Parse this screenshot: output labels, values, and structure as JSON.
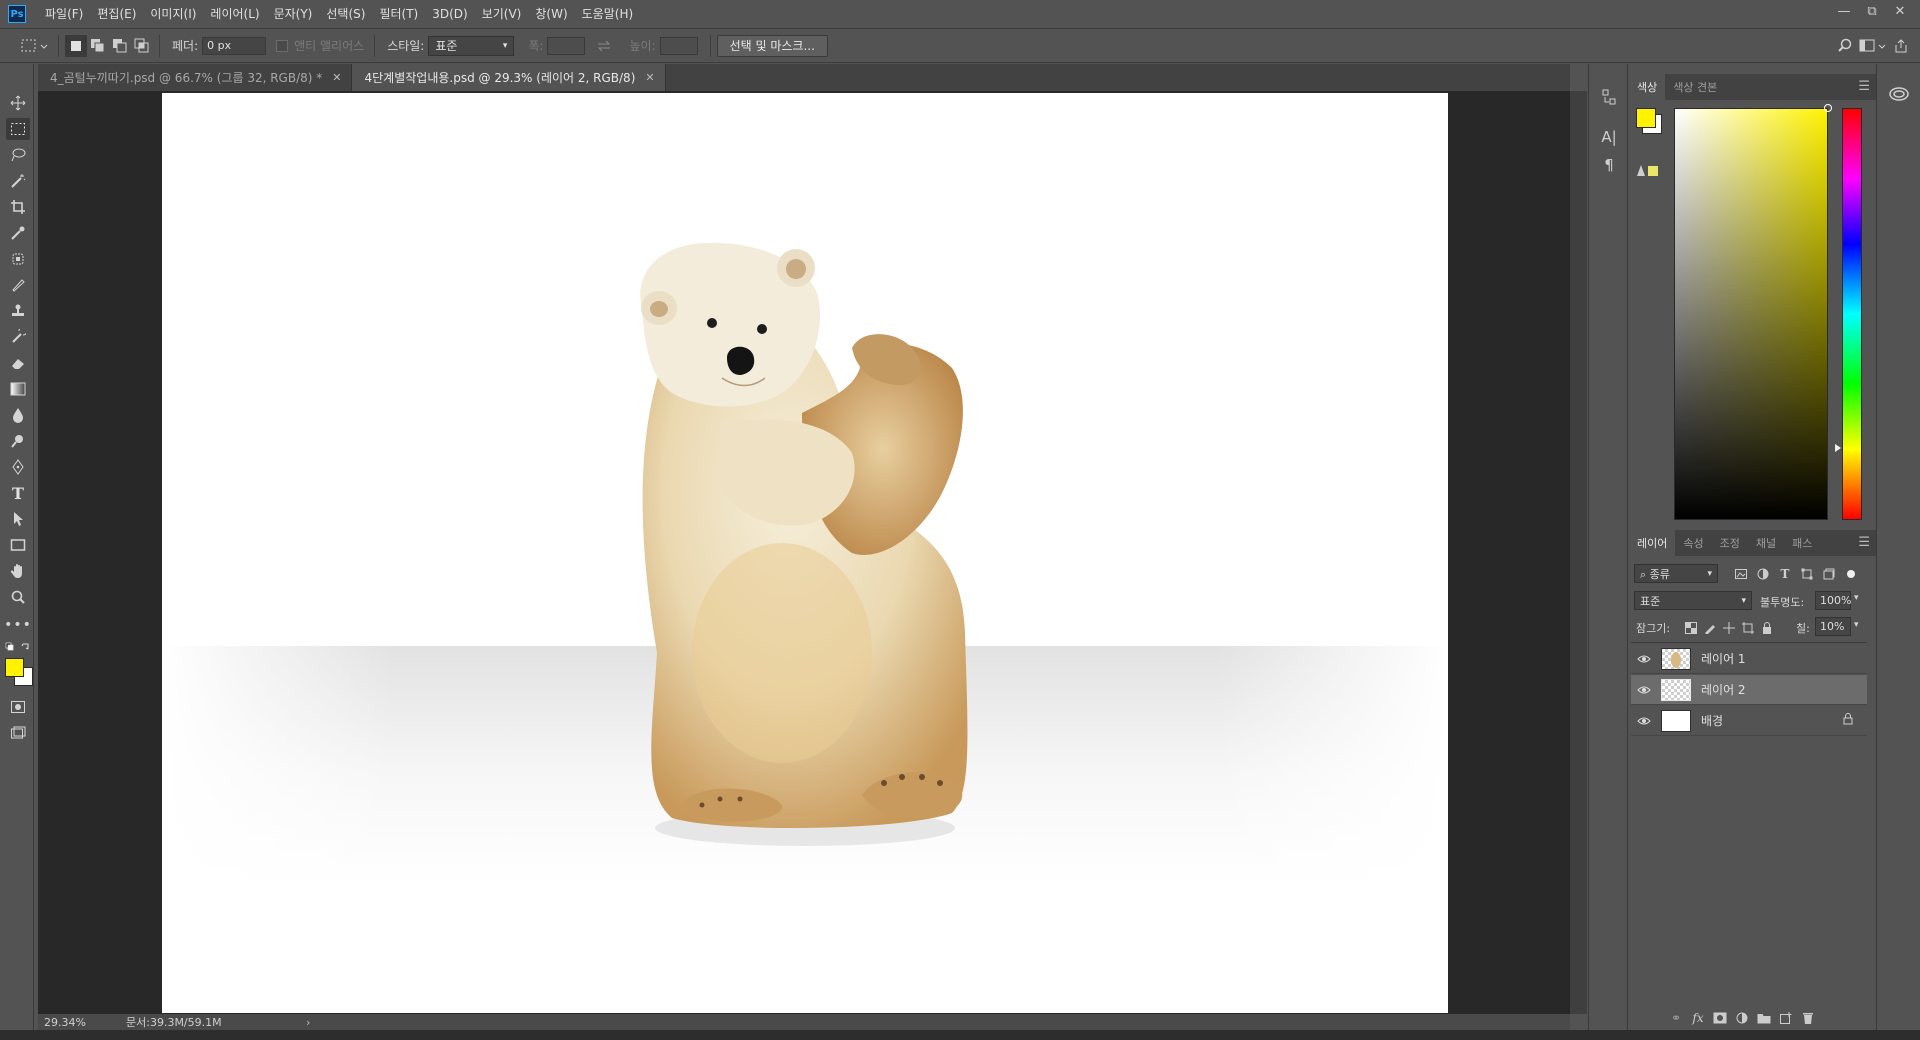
{
  "menubar": {
    "app_icon": "Ps",
    "items": [
      "파일(F)",
      "편집(E)",
      "이미지(I)",
      "레이어(L)",
      "문자(Y)",
      "선택(S)",
      "필터(T)",
      "3D(D)",
      "보기(V)",
      "창(W)",
      "도움말(H)"
    ]
  },
  "options": {
    "feather_label": "페더:",
    "feather_value": "0 px",
    "antialias_label": "앤티 앨리어스",
    "style_label": "스타일:",
    "style_value": "표준",
    "width_label": "폭:",
    "height_label": "높이:",
    "select_mask_button": "선택 및 마스크..."
  },
  "tabs": [
    {
      "label": "4_곰털누끼따기.psd @ 66.7% (그룹 32, RGB/8) *",
      "active": false
    },
    {
      "label": "4단계별작업내용.psd @ 29.3% (레이어 2, RGB/8)",
      "active": true
    }
  ],
  "status": {
    "zoom": "29.34%",
    "doc_size": "문서:39.3M/59.1M"
  },
  "colors": {
    "foreground": "#fff200",
    "background": "#ffffff"
  },
  "color_panel": {
    "tabs": [
      "색상",
      "색상 견본"
    ]
  },
  "layers_panel": {
    "tabs": [
      "레이어",
      "속성",
      "조정",
      "채널",
      "패스"
    ],
    "filter_kind": "종류",
    "blend_mode": "표준",
    "opacity_label": "불투명도:",
    "opacity_value": "100%",
    "lock_label": "잠그기:",
    "fill_label": "칠:",
    "fill_value": "10%",
    "layers": [
      {
        "name": "레이어 1",
        "visible": true,
        "selected": false,
        "locked": false
      },
      {
        "name": "레이어 2",
        "visible": true,
        "selected": true,
        "locked": false
      },
      {
        "name": "배경",
        "visible": true,
        "selected": false,
        "locked": true
      }
    ]
  }
}
